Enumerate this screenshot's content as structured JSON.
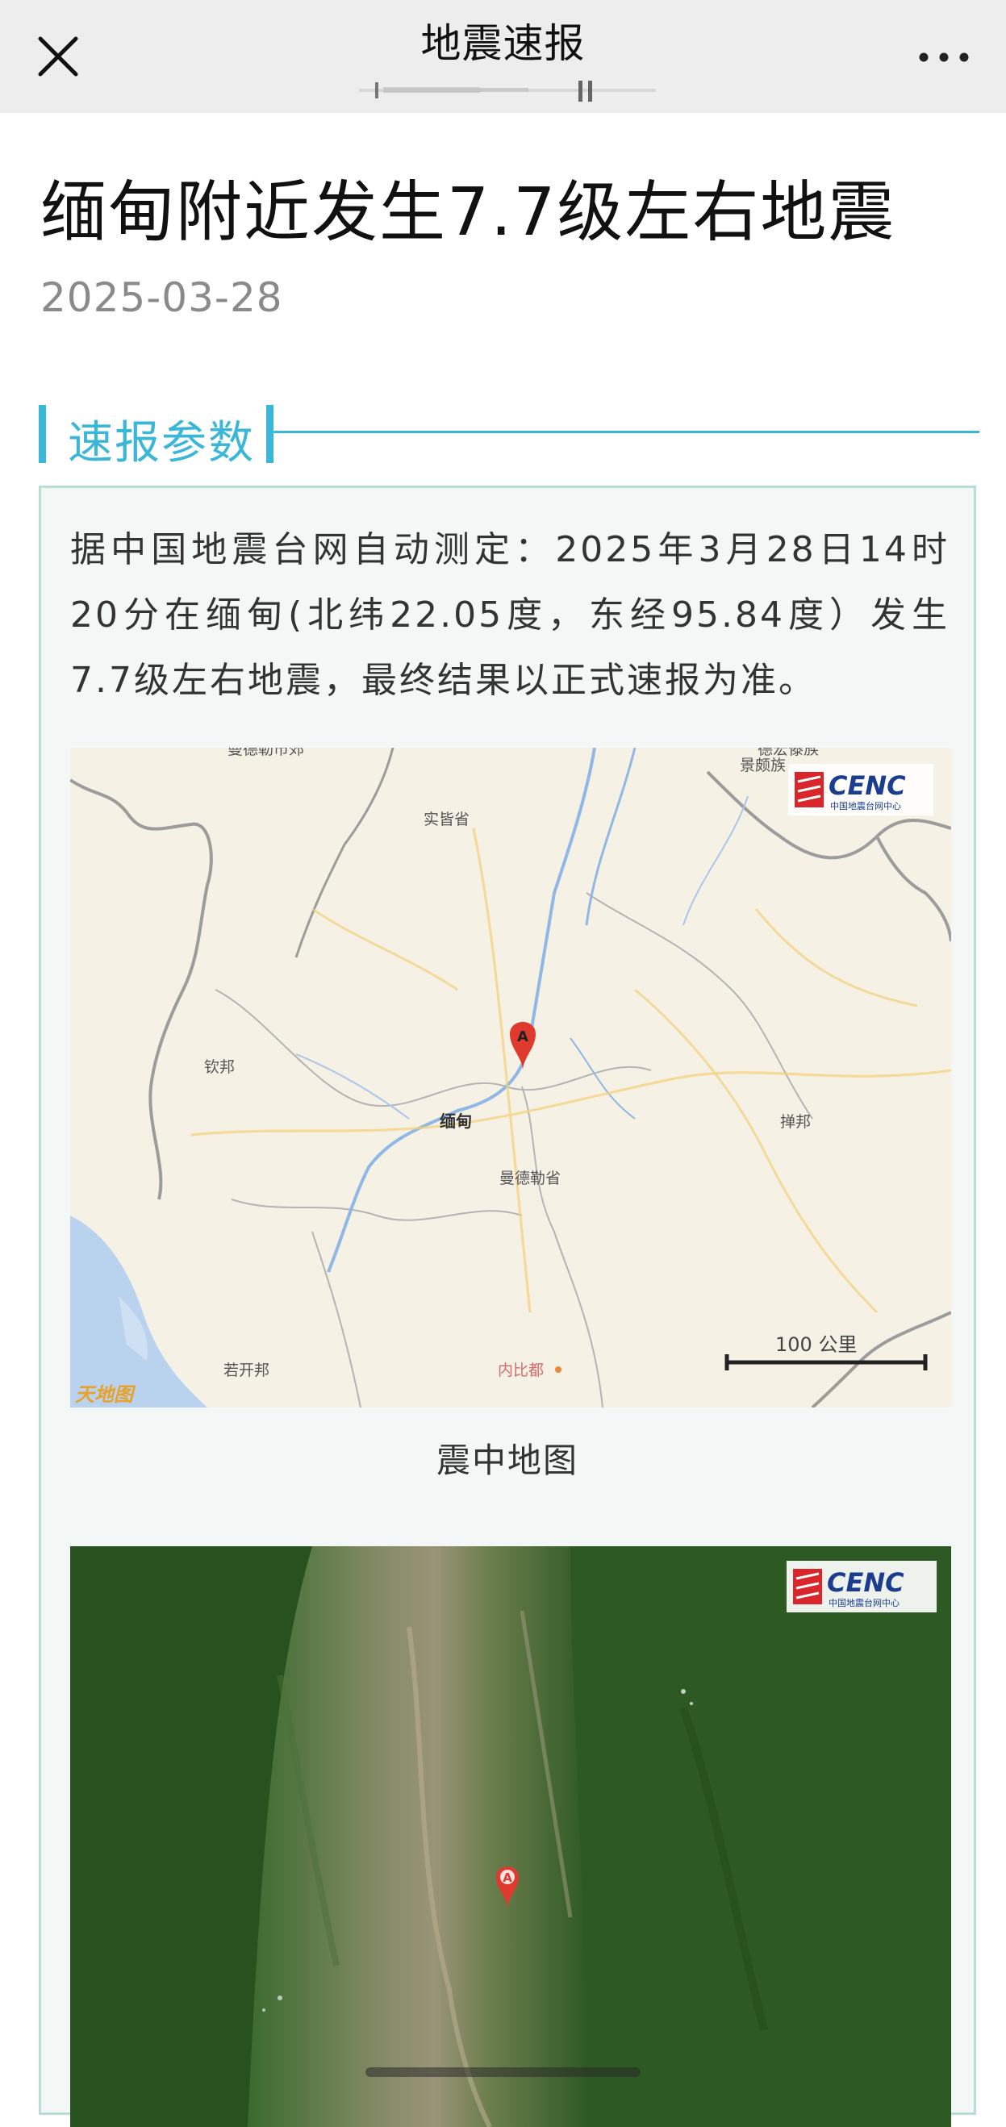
{
  "nav": {
    "title": "地震速报",
    "close_icon": "close-icon",
    "more_icon": "more-horizontal-icon"
  },
  "article": {
    "title": "缅甸附近发生7.7级左右地震",
    "date": "2025-03-28"
  },
  "section": {
    "label": "速报参数"
  },
  "report": {
    "text": "据中国地震台网自动测定：2025年3月28日14时20分在缅甸(北纬22.05度，东经95.84度）发生7.7级左右地震，最终结果以正式速报为准。"
  },
  "map_street": {
    "caption": "震中地图",
    "marker_label": "A",
    "scale_label": "100 公里",
    "logo_text": "CENC",
    "logo_subtext": "中国地震台网中心",
    "provider_logo": "天地图",
    "place_labels": {
      "top_left": "曼德勒市郊",
      "top_right": "德宏傣族",
      "top_right_2": "景颇族",
      "sagaing": "实皆省",
      "kachin": "钦邦",
      "myanmar": "缅甸",
      "shan": "掸邦",
      "mandalay": "曼德勒省",
      "rakhine": "若开邦",
      "naypyidaw": "内比都"
    }
  },
  "map_satellite": {
    "marker_label": "A",
    "logo_text": "CENC",
    "logo_subtext": "中国地震台网中心"
  },
  "colors": {
    "accent": "#3ab6d6",
    "card_border": "#b9dcd4",
    "card_bg": "#f3f8f7",
    "marker": "#e03a2e",
    "cenc_red": "#d8262a",
    "cenc_blue": "#1a3d8f"
  }
}
